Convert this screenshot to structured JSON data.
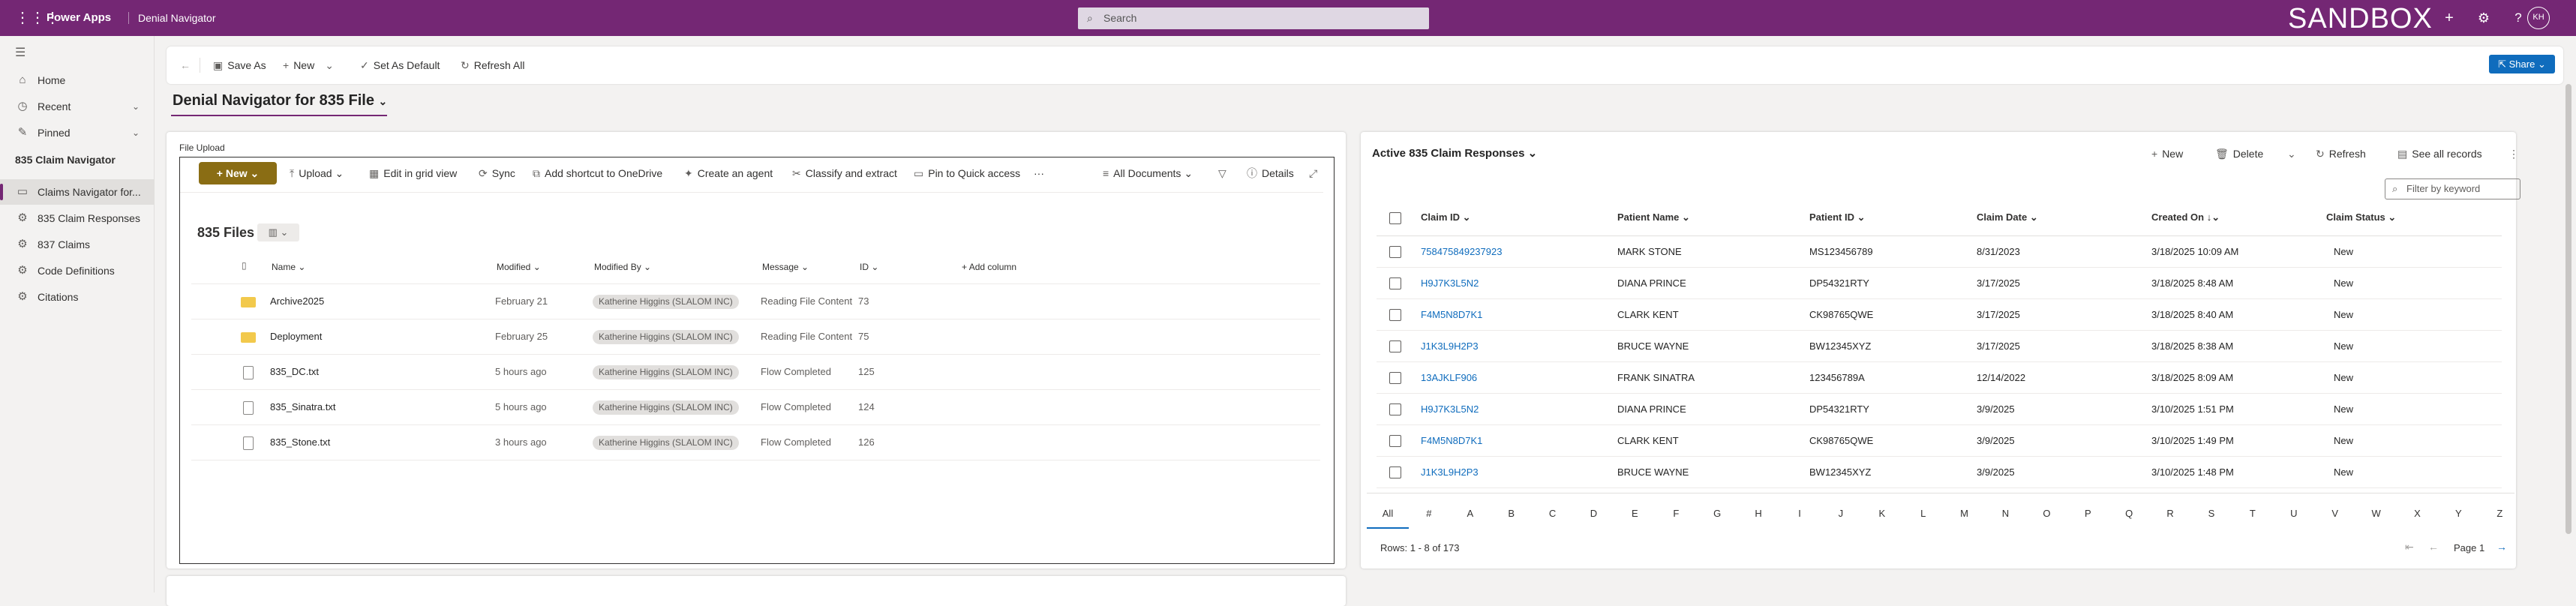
{
  "app": {
    "name": "Power Apps",
    "env_title": "Denial Navigator",
    "search_placeholder": "Search",
    "env_badge": "SANDBOX",
    "avatar": "KH"
  },
  "nav": {
    "items": [
      {
        "label": "Home"
      },
      {
        "label": "Recent"
      },
      {
        "label": "Pinned"
      }
    ],
    "group": "835 Claim Navigator",
    "group_items": [
      {
        "label": "Claims Navigator for..."
      },
      {
        "label": "835 Claim Responses"
      },
      {
        "label": "837 Claims"
      },
      {
        "label": "Code Definitions"
      },
      {
        "label": "Citations"
      }
    ]
  },
  "cmdbar": {
    "save_as": "Save As",
    "new": "New",
    "set_default": "Set As Default",
    "refresh_all": "Refresh All",
    "share": "Share"
  },
  "form": {
    "title": "Denial Navigator for 835 File",
    "section_label": "File Upload"
  },
  "sharepoint": {
    "new": "New",
    "upload": "Upload",
    "edit_grid": "Edit in grid view",
    "sync": "Sync",
    "add_shortcut": "Add shortcut to OneDrive",
    "create_agent": "Create an agent",
    "classify": "Classify and extract",
    "pin": "Pin to Quick access",
    "more": "···",
    "view": "All Documents",
    "details": "Details",
    "library_title": "835 Files",
    "columns": {
      "name": "Name",
      "modified": "Modified",
      "modified_by": "Modified By",
      "message": "Message",
      "id": "ID",
      "add_column": "Add column"
    },
    "rows": [
      {
        "type": "folder",
        "name": "Archive2025",
        "modified": "February 21",
        "by": "Katherine Higgins (SLALOM INC)",
        "message": "Reading File Content",
        "id": "73"
      },
      {
        "type": "folder",
        "name": "Deployment",
        "modified": "February 25",
        "by": "Katherine Higgins (SLALOM INC)",
        "message": "Reading File Content",
        "id": "75"
      },
      {
        "type": "file",
        "name": "835_DC.txt",
        "modified": "5 hours ago",
        "by": "Katherine Higgins (SLALOM INC)",
        "message": "Flow Completed",
        "id": "125"
      },
      {
        "type": "file",
        "name": "835_Sinatra.txt",
        "modified": "5 hours ago",
        "by": "Katherine Higgins (SLALOM INC)",
        "message": "Flow Completed",
        "id": "124"
      },
      {
        "type": "file",
        "name": "835_Stone.txt",
        "modified": "3 hours ago",
        "by": "Katherine Higgins (SLALOM INC)",
        "message": "Flow Completed",
        "id": "126"
      }
    ]
  },
  "grid": {
    "title": "Active 835 Claim Responses",
    "new": "New",
    "delete": "Delete",
    "refresh": "Refresh",
    "see_all": "See all records",
    "filter_placeholder": "Filter by keyword",
    "columns": {
      "claim_id": "Claim ID",
      "patient_name": "Patient Name",
      "patient_id": "Patient ID",
      "claim_date": "Claim Date",
      "created_on": "Created On",
      "claim_status": "Claim Status"
    },
    "rows": [
      {
        "claim_id": "758475849237923",
        "patient_name": "MARK STONE",
        "patient_id": "MS123456789",
        "claim_date": "8/31/2023",
        "created_on": "3/18/2025 10:09 AM",
        "status": "New"
      },
      {
        "claim_id": "H9J7K3L5N2",
        "patient_name": "DIANA PRINCE",
        "patient_id": "DP54321RTY",
        "claim_date": "3/17/2025",
        "created_on": "3/18/2025 8:48 AM",
        "status": "New"
      },
      {
        "claim_id": "F4M5N8D7K1",
        "patient_name": "CLARK KENT",
        "patient_id": "CK98765QWE",
        "claim_date": "3/17/2025",
        "created_on": "3/18/2025 8:40 AM",
        "status": "New"
      },
      {
        "claim_id": "J1K3L9H2P3",
        "patient_name": "BRUCE WAYNE",
        "patient_id": "BW12345XYZ",
        "claim_date": "3/17/2025",
        "created_on": "3/18/2025 8:38 AM",
        "status": "New"
      },
      {
        "claim_id": "13AJKLF906",
        "patient_name": "FRANK SINATRA",
        "patient_id": "123456789A",
        "claim_date": "12/14/2022",
        "created_on": "3/18/2025 8:09 AM",
        "status": "New"
      },
      {
        "claim_id": "H9J7K3L5N2",
        "patient_name": "DIANA PRINCE",
        "patient_id": "DP54321RTY",
        "claim_date": "3/9/2025",
        "created_on": "3/10/2025 1:51 PM",
        "status": "New"
      },
      {
        "claim_id": "F4M5N8D7K1",
        "patient_name": "CLARK KENT",
        "patient_id": "CK98765QWE",
        "claim_date": "3/9/2025",
        "created_on": "3/10/2025 1:49 PM",
        "status": "New"
      },
      {
        "claim_id": "J1K3L9H2P3",
        "patient_name": "BRUCE WAYNE",
        "patient_id": "BW12345XYZ",
        "claim_date": "3/9/2025",
        "created_on": "3/10/2025 1:48 PM",
        "status": "New"
      }
    ],
    "alphabet": [
      "All",
      "#",
      "A",
      "B",
      "C",
      "D",
      "E",
      "F",
      "G",
      "H",
      "I",
      "J",
      "K",
      "L",
      "M",
      "N",
      "O",
      "P",
      "Q",
      "R",
      "S",
      "T",
      "U",
      "V",
      "W",
      "X",
      "Y",
      "Z"
    ],
    "footer": "Rows: 1 - 8 of 173",
    "page": "Page 1"
  },
  "colors": {
    "brand": "#742774",
    "link": "#0f6cbd",
    "new_button": "#8a6d14"
  }
}
